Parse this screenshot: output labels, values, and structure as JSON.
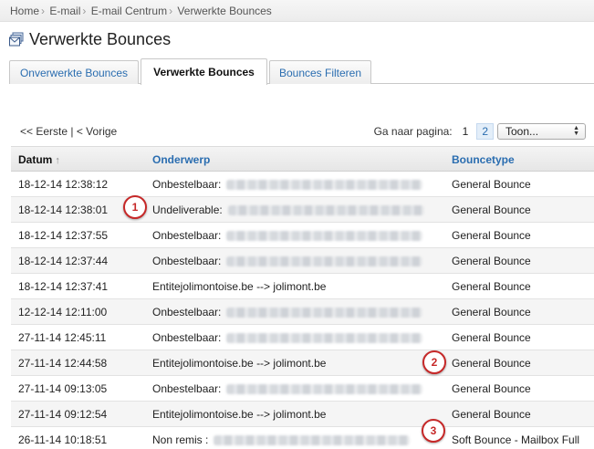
{
  "breadcrumb": [
    "Home",
    "E-mail",
    "E-mail Centrum",
    "Verwerkte Bounces"
  ],
  "page": {
    "title": "Verwerkte Bounces"
  },
  "tabs": [
    {
      "label": "Onverwerkte Bounces",
      "active": false
    },
    {
      "label": "Verwerkte Bounces",
      "active": true
    },
    {
      "label": "Bounces Filteren",
      "active": false
    }
  ],
  "pager": {
    "first_label": "<< Eerste",
    "separator": "|",
    "prev_label": "< Vorige",
    "goto_label": "Ga naar pagina:",
    "pages": [
      "1",
      "2"
    ],
    "current_page": "2",
    "show_select": "Toon..."
  },
  "table": {
    "headers": {
      "datum": "Datum",
      "onderwerp": "Onderwerp",
      "bouncetype": "Bouncetype"
    },
    "rows": [
      {
        "datum": "18-12-14 12:38:12",
        "onderwerp": "Onbestelbaar:",
        "blurred": true,
        "bouncetype": "General Bounce"
      },
      {
        "datum": "18-12-14 12:38:01",
        "onderwerp": "Undeliverable:",
        "blurred": true,
        "bouncetype": "General Bounce"
      },
      {
        "datum": "18-12-14 12:37:55",
        "onderwerp": "Onbestelbaar:",
        "blurred": true,
        "bouncetype": "General Bounce"
      },
      {
        "datum": "18-12-14 12:37:44",
        "onderwerp": "Onbestelbaar:",
        "blurred": true,
        "bouncetype": "General Bounce"
      },
      {
        "datum": "18-12-14 12:37:41",
        "onderwerp": "Entitejolimontoise.be --> jolimont.be",
        "blurred": false,
        "bouncetype": "General Bounce"
      },
      {
        "datum": "12-12-14 12:11:00",
        "onderwerp": "Onbestelbaar:",
        "blurred": true,
        "bouncetype": "General Bounce"
      },
      {
        "datum": "27-11-14 12:45:11",
        "onderwerp": "Onbestelbaar:",
        "blurred": true,
        "bouncetype": "General Bounce"
      },
      {
        "datum": "27-11-14 12:44:58",
        "onderwerp": "Entitejolimontoise.be --> jolimont.be",
        "blurred": false,
        "bouncetype": "General Bounce"
      },
      {
        "datum": "27-11-14 09:13:05",
        "onderwerp": "Onbestelbaar:",
        "blurred": true,
        "bouncetype": "General Bounce"
      },
      {
        "datum": "27-11-14 09:12:54",
        "onderwerp": "Entitejolimontoise.be --> jolimont.be",
        "blurred": false,
        "bouncetype": "General Bounce"
      },
      {
        "datum": "26-11-14 10:18:51",
        "onderwerp": "Non remis :",
        "blurred": true,
        "bouncetype": "Soft Bounce - Mailbox Full"
      }
    ]
  },
  "callouts": [
    "1",
    "2",
    "3"
  ],
  "colors": {
    "link": "#2a6db0",
    "callout": "#c62828"
  }
}
